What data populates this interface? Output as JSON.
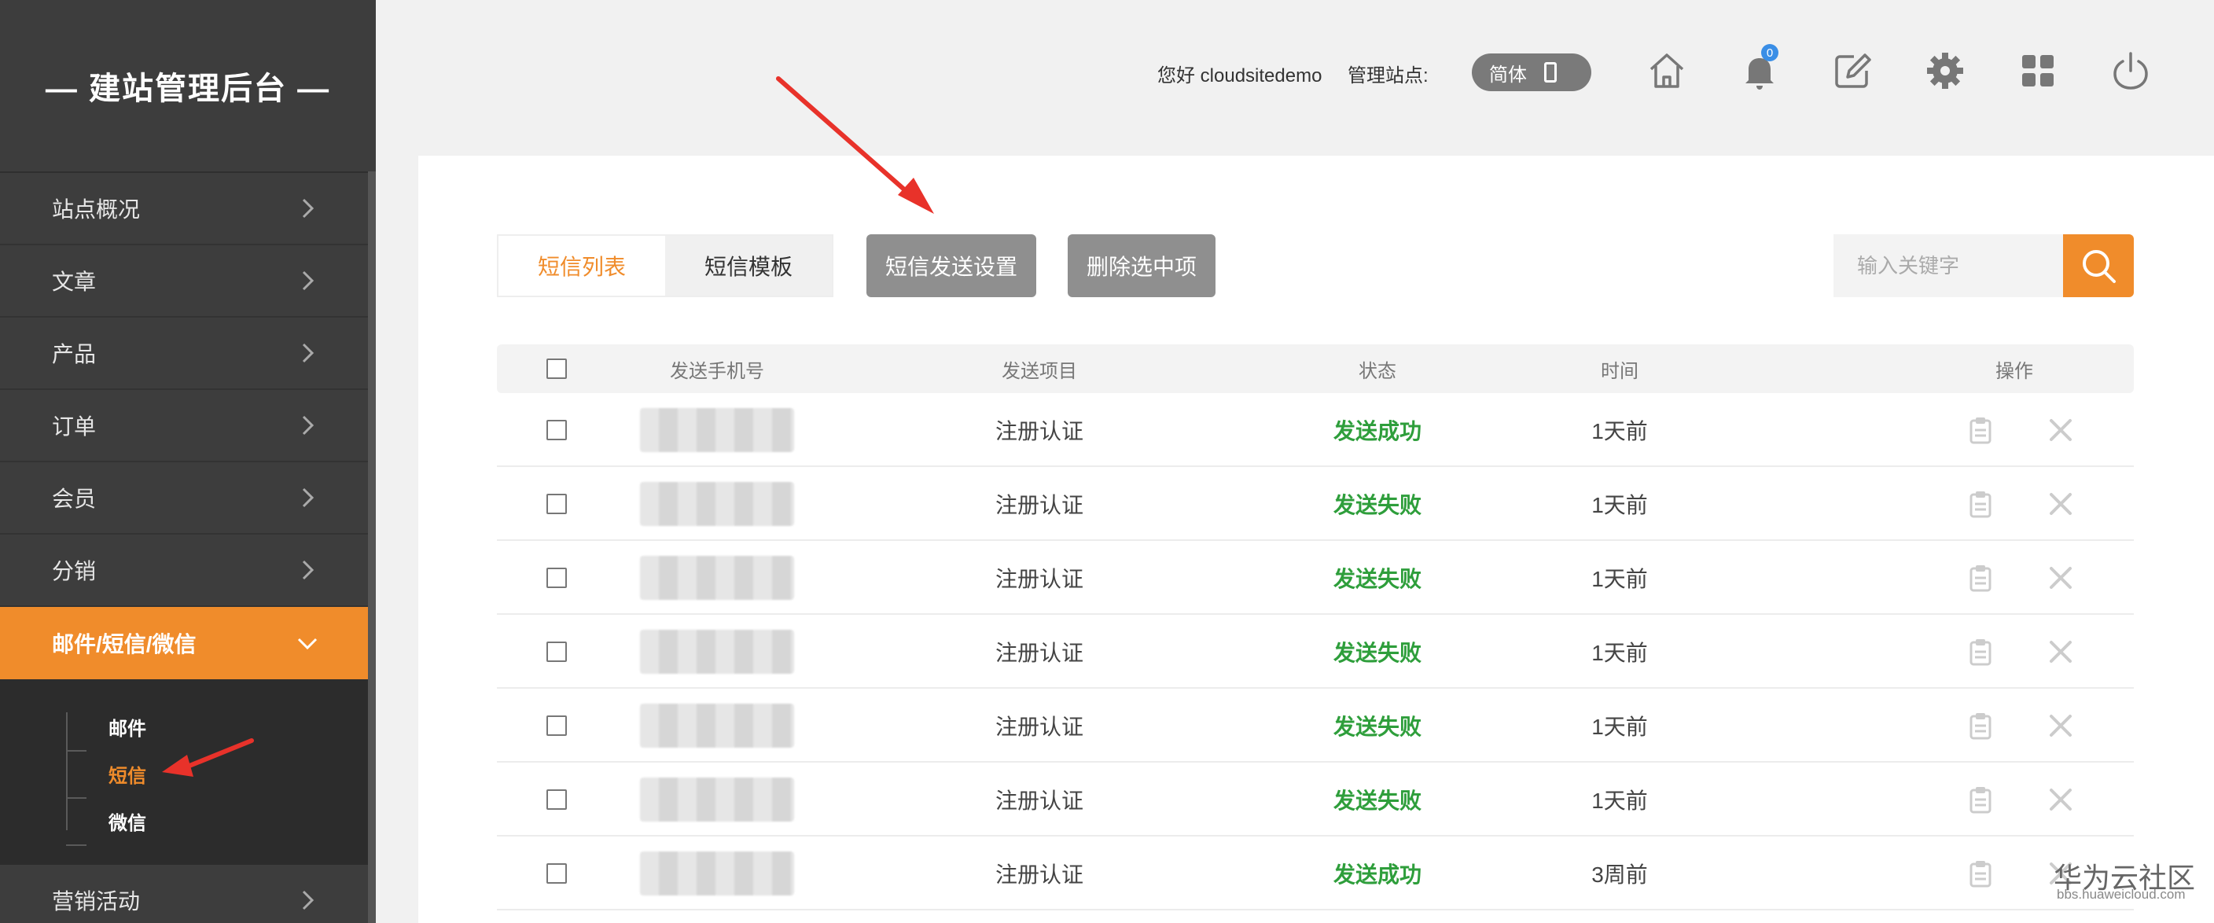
{
  "sidebar": {
    "brand": "— 建站管理后台 —",
    "items": [
      {
        "label": "站点概况"
      },
      {
        "label": "文章"
      },
      {
        "label": "产品"
      },
      {
        "label": "订单"
      },
      {
        "label": "会员"
      },
      {
        "label": "分销"
      },
      {
        "label": "邮件/短信/微信"
      },
      {
        "label": "营销活动"
      }
    ],
    "submenu": [
      {
        "label": "邮件"
      },
      {
        "label": "短信"
      },
      {
        "label": "微信"
      }
    ]
  },
  "header": {
    "greeting": "您好 cloudsitedemo",
    "site_label": "管理站点:",
    "lang": "简体",
    "notification_count": "0",
    "icons": [
      "home-icon",
      "bell-icon",
      "edit-icon",
      "gear-icon",
      "grid-icon",
      "power-icon"
    ]
  },
  "toolbar": {
    "tabs": [
      {
        "label": "短信列表"
      },
      {
        "label": "短信模板"
      }
    ],
    "settings_button": "短信发送设置",
    "delete_button": "删除选中项",
    "search_placeholder": "输入关键字"
  },
  "table": {
    "headers": {
      "phone": "发送手机号",
      "project": "发送项目",
      "status": "状态",
      "time": "时间",
      "actions": "操作"
    },
    "rows": [
      {
        "project": "注册认证",
        "status": "发送成功",
        "time": "1天前"
      },
      {
        "project": "注册认证",
        "status": "发送失败",
        "time": "1天前"
      },
      {
        "project": "注册认证",
        "status": "发送失败",
        "time": "1天前"
      },
      {
        "project": "注册认证",
        "status": "发送失败",
        "time": "1天前"
      },
      {
        "project": "注册认证",
        "status": "发送失败",
        "time": "1天前"
      },
      {
        "project": "注册认证",
        "status": "发送失败",
        "time": "1天前"
      },
      {
        "project": "注册认证",
        "status": "发送成功",
        "time": "3周前"
      }
    ]
  },
  "watermark": {
    "main": "华为云社区",
    "sub": "bbs.huaweicloud.com"
  },
  "colors": {
    "accent": "#f08c2b",
    "sidebar_bg": "#3d3d3d",
    "status_green": "#2e9e3b",
    "button_gray": "#8f8f8f",
    "annotation_red": "#e8322a"
  }
}
